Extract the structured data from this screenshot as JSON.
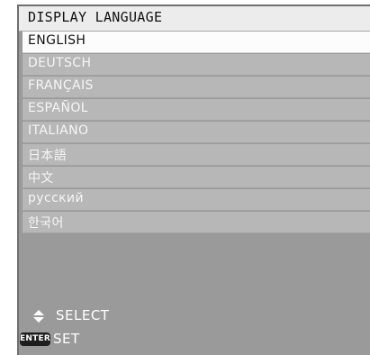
{
  "menu": {
    "title": "DISPLAY LANGUAGE",
    "selected_index": 0,
    "languages": [
      "ENGLISH",
      "DEUTSCH",
      "FRANÇAIS",
      "ESPAÑOL",
      "ITALIANO",
      "日本語",
      "中文",
      "русский",
      "한국어"
    ]
  },
  "footer": {
    "select_icon": "up-down-arrows-icon",
    "select_label": "SELECT",
    "enter_key_label": "ENTER",
    "set_label": "SET"
  },
  "colors": {
    "title_bar": "#ececec",
    "panel_background": "#9a9a9a",
    "row_background": "#b7b7b7",
    "selected_row_background": "#fcfcfc",
    "text_light": "#ffffff",
    "text_dark": "#111111"
  }
}
